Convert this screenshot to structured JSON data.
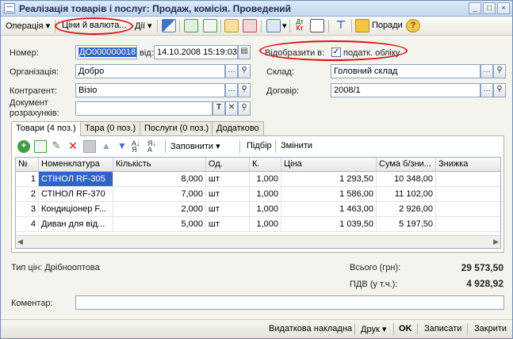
{
  "window": {
    "title": "Реалізація товарів і послуг: Продаж, комісія. Проведений",
    "btn_min": "_",
    "btn_max": "□",
    "btn_close": "×"
  },
  "toolbar": {
    "operation": "Операція",
    "prices": "Ціни й валюта...",
    "actions": "Дії",
    "advice": "Поради"
  },
  "form": {
    "number_label": "Номер:",
    "number_value": "ДО000000018",
    "date_label": "від:",
    "date_value": "14.10.2008 15:19:03",
    "show_in_label": "Відобразити в:",
    "tax_account_label": "податк. обліку",
    "org_label": "Організація:",
    "org_value": "Добро",
    "warehouse_label": "Склад:",
    "warehouse_value": "Головний склад",
    "contractor_label": "Контрагент:",
    "contractor_value": "Візіо",
    "contract_label": "Договір:",
    "contract_value": "2008/1",
    "payment_doc_label_1": "Документ",
    "payment_doc_label_2": "розрахунків:",
    "payment_doc_value": ""
  },
  "tabs": [
    {
      "label": "Товари (4 поз.)"
    },
    {
      "label": "Тара (0 поз.)"
    },
    {
      "label": "Послуги (0 поз.)"
    },
    {
      "label": "Додатково"
    }
  ],
  "grid_toolbar": {
    "fill": "Заповнити",
    "select": "Підбір",
    "change": "Змінити"
  },
  "grid": {
    "columns": [
      "№",
      "Номенклатура",
      "Кількість",
      "Од.",
      "К.",
      "Ціна",
      "Сума б/зни...",
      "Знижка"
    ],
    "rows": [
      [
        "1",
        "СТІНОЛ RF-305",
        "8,000",
        "шт",
        "1,000",
        "1 293,50",
        "10 348,00",
        ""
      ],
      [
        "2",
        "СТІНОЛ RF-370",
        "7,000",
        "шт",
        "1,000",
        "1 586,00",
        "11 102,00",
        ""
      ],
      [
        "3",
        "Кондиціонер F...",
        "2,000",
        "шт",
        "1,000",
        "1 463,00",
        "2 926,00",
        ""
      ],
      [
        "4",
        "Диван для від...",
        "5,000",
        "шт",
        "1,000",
        "1 039,50",
        "5 197,50",
        ""
      ]
    ]
  },
  "summary": {
    "price_type": "Тип цін: Дрібнооптова",
    "total_label": "Всього (грн):",
    "total_value": "29 573,50",
    "vat_label": "ПДВ (у т.ч.):",
    "vat_value": "4 928,92"
  },
  "comment": {
    "label": "Коментар:",
    "value": ""
  },
  "bottom": {
    "invoice": "Видаткова накладна",
    "print": "Друк",
    "ok": "OK",
    "save": "Записати",
    "close": "Закрити"
  },
  "colors": {
    "oval": "#d11111",
    "selected_cell": "#3165c5"
  }
}
